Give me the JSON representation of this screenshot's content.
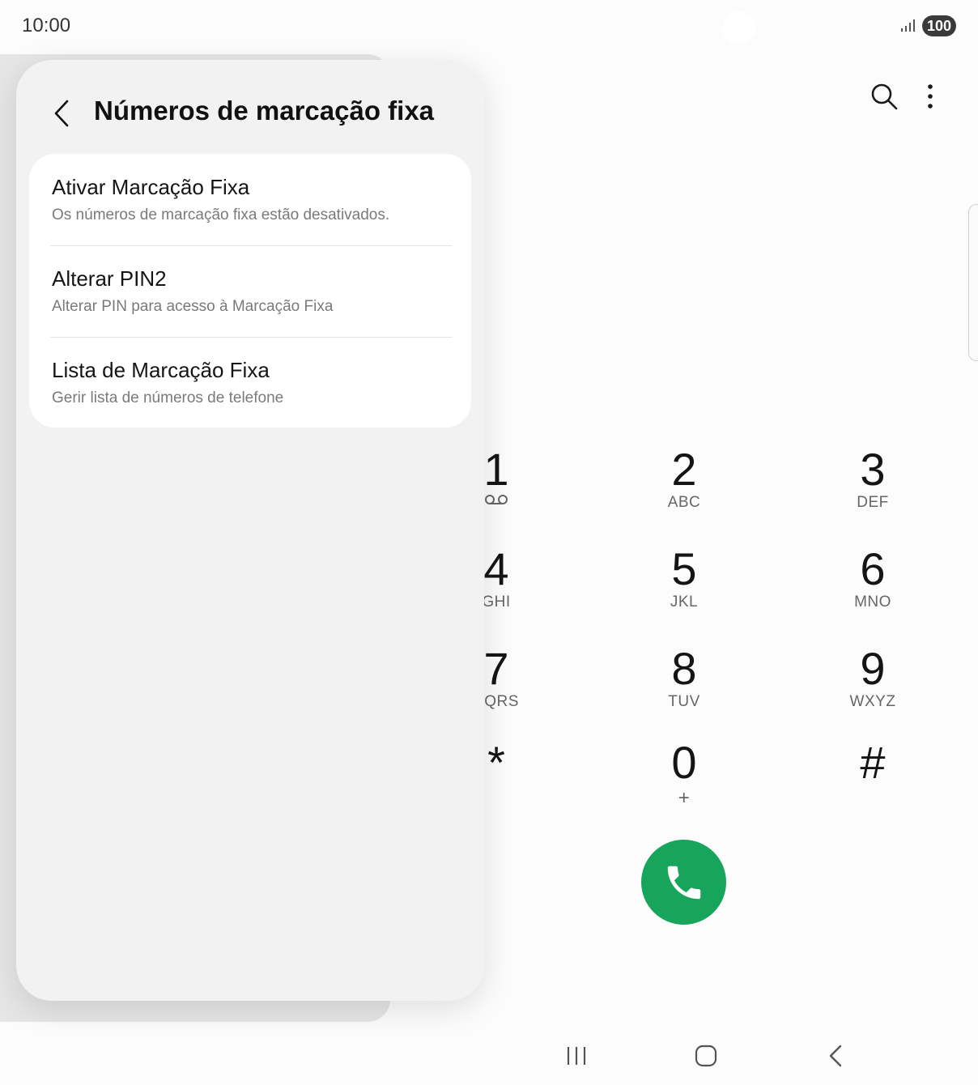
{
  "status": {
    "time": "10:00",
    "battery": "100"
  },
  "dialpad": {
    "keys": [
      {
        "digit": "1",
        "letters": ""
      },
      {
        "digit": "2",
        "letters": "ABC"
      },
      {
        "digit": "3",
        "letters": "DEF"
      },
      {
        "digit": "4",
        "letters": "GHI"
      },
      {
        "digit": "5",
        "letters": "JKL"
      },
      {
        "digit": "6",
        "letters": "MNO"
      },
      {
        "digit": "7",
        "letters": "PQRS"
      },
      {
        "digit": "8",
        "letters": "TUV"
      },
      {
        "digit": "9",
        "letters": "WXYZ"
      },
      {
        "digit": "*",
        "letters": ""
      },
      {
        "digit": "0",
        "letters": "+"
      },
      {
        "digit": "#",
        "letters": ""
      }
    ],
    "call_color": "#16a55a"
  },
  "panel": {
    "title": "Números de marcação fixa",
    "items": [
      {
        "title": "Ativar Marcação Fixa",
        "subtitle": "Os números de marcação fixa estão desativados."
      },
      {
        "title": "Alterar PIN2",
        "subtitle": "Alterar PIN para acesso à Marcação Fixa"
      },
      {
        "title": "Lista de Marcação Fixa",
        "subtitle": "Gerir lista de números de telefone"
      }
    ]
  },
  "icons": {
    "back": "chevron-left-icon",
    "search": "search-icon",
    "more": "more-vertical-icon",
    "call": "phone-icon",
    "voicemail": "voicemail-icon",
    "nav_recents": "recents-icon",
    "nav_home": "home-icon",
    "nav_back": "back-icon"
  }
}
